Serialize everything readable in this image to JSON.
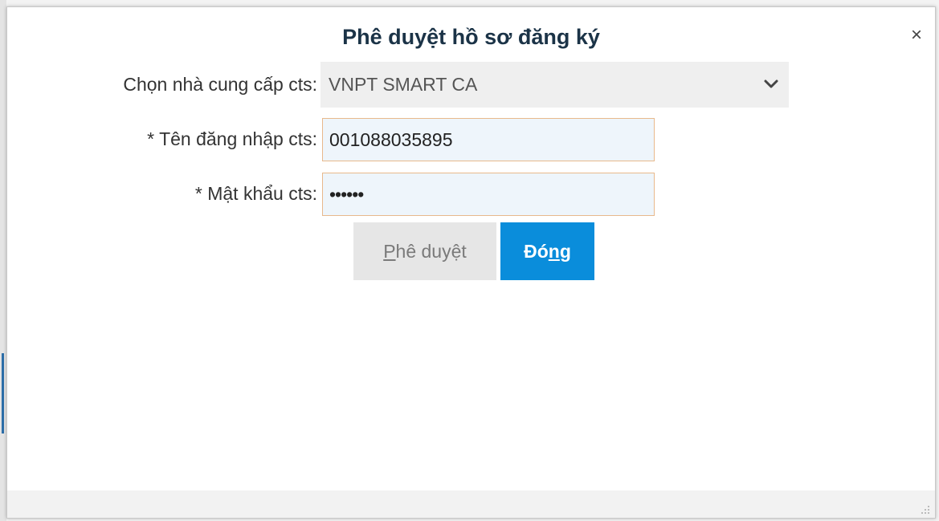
{
  "dialog": {
    "title": "Phê duyệt hồ sơ đăng ký",
    "close_glyph": "×"
  },
  "form": {
    "provider_label": "Chọn nhà cung cấp cts:",
    "provider_value": "VNPT SMART CA",
    "username_label": "* Tên đăng nhập cts:",
    "username_value": "001088035895",
    "password_label": "* Mật khẩu cts:",
    "password_value": "••••••"
  },
  "buttons": {
    "approve": {
      "pre": "",
      "accel": "P",
      "post": "hê duyệt"
    },
    "close": {
      "pre": "Đó",
      "accel": "n",
      "post": "g"
    }
  },
  "icons": {
    "close": "close-icon",
    "dropdown": "chevron-down-icon",
    "resize": "resize-grip-icon"
  },
  "colors": {
    "primary_button": "#0a8ddb",
    "secondary_button": "#e6e6e6",
    "input_border": "#e8b98c",
    "input_background": "#eef5fb",
    "title_text": "#1b3347"
  }
}
